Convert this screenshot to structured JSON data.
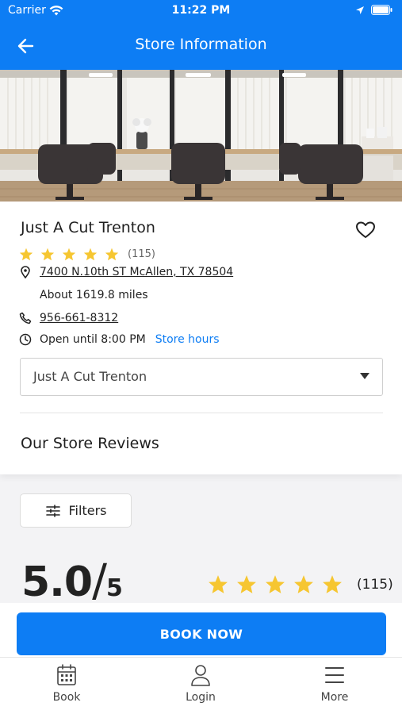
{
  "status_bar": {
    "carrier": "Carrier",
    "time": "11:22 PM"
  },
  "header": {
    "title": "Store Information"
  },
  "store": {
    "name": "Just A Cut Trenton",
    "rating_stars": 5,
    "review_count": "(115)",
    "address": "7400 N.10th ST McAllen, TX 78504",
    "distance": "About 1619.8 miles",
    "phone": "956-661-8312",
    "hours_text": "Open until 8:00 PM",
    "hours_link": "Store hours"
  },
  "store_select": {
    "selected": "Just A Cut Trenton"
  },
  "reviews": {
    "title": "Our Store Reviews",
    "filters_label": "Filters",
    "score": "5.0",
    "slash": "/",
    "out_of": "5",
    "stars": 5,
    "count": "(115)"
  },
  "book_button": {
    "label": "BOOK NOW"
  },
  "tabbar": {
    "book": "Book",
    "login": "Login",
    "more": "More"
  },
  "colors": {
    "primary": "#0d7df4",
    "star": "#f6c631"
  },
  "icons": {
    "back": "arrow-left-icon",
    "favorite": "heart-outline-icon",
    "location": "map-pin-icon",
    "phone": "phone-icon",
    "clock": "clock-icon",
    "filters": "sliders-icon",
    "book": "calendar-icon",
    "login": "user-icon",
    "more": "menu-icon"
  }
}
